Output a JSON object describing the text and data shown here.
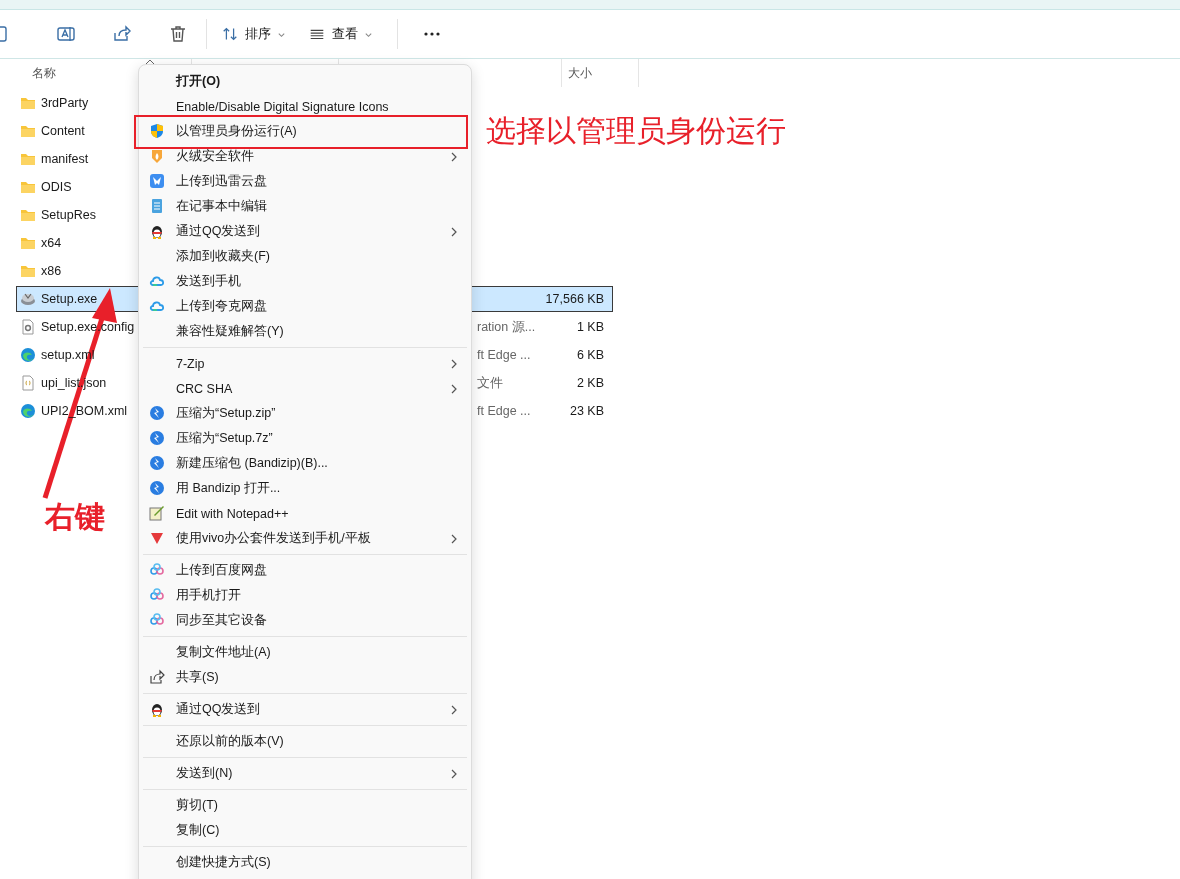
{
  "toolbar": {
    "sort_label": "排序",
    "view_label": "查看"
  },
  "columns": {
    "name": "名称",
    "size": "大小"
  },
  "files": [
    {
      "name": "3rdParty",
      "kind": "folder",
      "selected": false
    },
    {
      "name": "Content",
      "kind": "folder",
      "selected": false
    },
    {
      "name": "manifest",
      "kind": "folder",
      "selected": false
    },
    {
      "name": "ODIS",
      "kind": "folder",
      "selected": false
    },
    {
      "name": "SetupRes",
      "kind": "folder",
      "selected": false
    },
    {
      "name": "x64",
      "kind": "folder",
      "selected": false
    },
    {
      "name": "x86",
      "kind": "folder",
      "selected": false
    },
    {
      "name": "Setup.exe",
      "kind": "exe",
      "size": "17,566 KB",
      "selected": true
    },
    {
      "name": "Setup.exe.config",
      "kind": "config",
      "type": "ration 源...",
      "size": "1 KB",
      "selected": false
    },
    {
      "name": "setup.xml",
      "kind": "edge",
      "type": "ft Edge ...",
      "size": "6 KB",
      "selected": false
    },
    {
      "name": "upi_list.json",
      "kind": "json",
      "type": "文件",
      "size": "2 KB",
      "selected": false
    },
    {
      "name": "UPI2_BOM.xml",
      "kind": "edge",
      "type": "ft Edge ...",
      "size": "23 KB",
      "selected": false
    }
  ],
  "menu": [
    {
      "kind": "plain",
      "label": "打开(O)",
      "bold": true,
      "submenu": false
    },
    {
      "kind": "plain",
      "label": "Enable/Disable Digital Signature Icons",
      "bold": false,
      "submenu": false
    },
    {
      "kind": "shield",
      "label": "以管理员身份运行(A)",
      "bold": false,
      "submenu": false
    },
    {
      "kind": "flame",
      "label": "火绒安全软件",
      "bold": false,
      "submenu": true
    },
    {
      "kind": "bird",
      "label": "上传到迅雷云盘",
      "bold": false,
      "submenu": false
    },
    {
      "kind": "notepad",
      "label": "在记事本中编辑",
      "bold": false,
      "submenu": false
    },
    {
      "kind": "penguin",
      "label": "通过QQ发送到",
      "bold": false,
      "submenu": true
    },
    {
      "kind": "plain",
      "label": "添加到收藏夹(F)",
      "bold": false,
      "submenu": false
    },
    {
      "kind": "cloud",
      "label": "发送到手机",
      "bold": false,
      "submenu": false
    },
    {
      "kind": "cloud",
      "label": "上传到夸克网盘",
      "bold": false,
      "submenu": false
    },
    {
      "kind": "plain",
      "label": "兼容性疑难解答(Y)",
      "bold": false,
      "submenu": false
    },
    {
      "kind": "separator"
    },
    {
      "kind": "plain",
      "label": "7-Zip",
      "bold": false,
      "submenu": true
    },
    {
      "kind": "plain",
      "label": "CRC SHA",
      "bold": false,
      "submenu": true
    },
    {
      "kind": "bolt",
      "label": "压缩为“Setup.zip”",
      "bold": false,
      "submenu": false
    },
    {
      "kind": "bolt",
      "label": "压缩为“Setup.7z”",
      "bold": false,
      "submenu": false
    },
    {
      "kind": "bolt",
      "label": "新建压缩包 (Bandizip)(B)...",
      "bold": false,
      "submenu": false
    },
    {
      "kind": "bolt",
      "label": "用 Bandizip 打开...",
      "bold": false,
      "submenu": false
    },
    {
      "kind": "pencil",
      "label": "Edit with Notepad++",
      "bold": false,
      "submenu": false
    },
    {
      "kind": "vivo",
      "label": "使用vivo办公套件发送到手机/平板",
      "bold": false,
      "submenu": true
    },
    {
      "kind": "separator"
    },
    {
      "kind": "rings",
      "label": "上传到百度网盘",
      "bold": false,
      "submenu": false
    },
    {
      "kind": "rings",
      "label": "用手机打开",
      "bold": false,
      "submenu": false
    },
    {
      "kind": "rings",
      "label": "同步至其它设备",
      "bold": false,
      "submenu": false
    },
    {
      "kind": "separator"
    },
    {
      "kind": "plain",
      "label": "复制文件地址(A)",
      "bold": false,
      "submenu": false
    },
    {
      "kind": "share",
      "label": "共享(S)",
      "bold": false,
      "submenu": false
    },
    {
      "kind": "separator"
    },
    {
      "kind": "penguin",
      "label": "通过QQ发送到",
      "bold": false,
      "submenu": true
    },
    {
      "kind": "separator"
    },
    {
      "kind": "plain",
      "label": "还原以前的版本(V)",
      "bold": false,
      "submenu": false
    },
    {
      "kind": "separator"
    },
    {
      "kind": "plain",
      "label": "发送到(N)",
      "bold": false,
      "submenu": true
    },
    {
      "kind": "separator"
    },
    {
      "kind": "plain",
      "label": "剪切(T)",
      "bold": false,
      "submenu": false
    },
    {
      "kind": "plain",
      "label": "复制(C)",
      "bold": false,
      "submenu": false
    },
    {
      "kind": "separator"
    },
    {
      "kind": "plain",
      "label": "创建快捷方式(S)",
      "bold": false,
      "submenu": false
    }
  ],
  "annotations": {
    "callout": "选择以管理员身份运行",
    "right_click_label": "右键"
  }
}
